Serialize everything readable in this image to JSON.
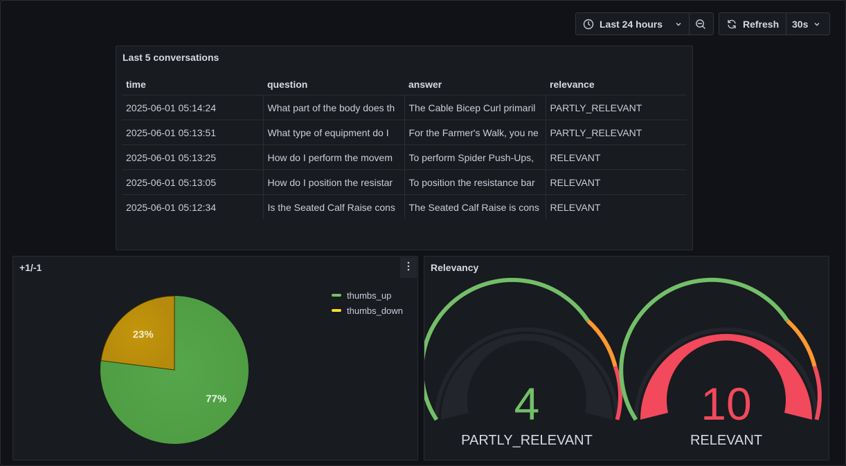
{
  "toolbar": {
    "time_range_label": "Last 24 hours",
    "refresh_label": "Refresh",
    "interval_label": "30s"
  },
  "table_panel": {
    "title": "Last 5 conversations",
    "columns": [
      "time",
      "question",
      "answer",
      "relevance"
    ],
    "rows": [
      [
        "2025-06-01 05:14:24",
        "What part of the body does th",
        "The Cable Bicep Curl primaril",
        "PARTLY_RELEVANT"
      ],
      [
        "2025-06-01 05:13:51",
        "What type of equipment do I",
        "For the Farmer's Walk, you ne",
        "PARTLY_RELEVANT"
      ],
      [
        "2025-06-01 05:13:25",
        "How do I perform the movem",
        "To perform Spider Push-Ups,",
        "RELEVANT"
      ],
      [
        "2025-06-01 05:13:05",
        "How do I position the resistar",
        "To position the resistance bar",
        "RELEVANT"
      ],
      [
        "2025-06-01 05:12:34",
        "Is the Seated Calf Raise cons",
        "The Seated Calf Raise is cons",
        "RELEVANT"
      ]
    ]
  },
  "pie_panel": {
    "title": "+1/-1",
    "legend": [
      {
        "name": "thumbs_up",
        "color": "#73bf69"
      },
      {
        "name": "thumbs_down",
        "color": "#fade2a"
      }
    ],
    "labels": [
      "77%",
      "23%"
    ]
  },
  "gauge_panel": {
    "title": "Relevancy",
    "gauges": [
      {
        "value": "4",
        "label": "PARTLY_RELEVANT",
        "color": "#73bf69"
      },
      {
        "value": "10",
        "label": "RELEVANT",
        "color": "#f2495c"
      }
    ]
  },
  "chart_data": [
    {
      "type": "pie",
      "categories": [
        "thumbs_up",
        "thumbs_down"
      ],
      "values": [
        77,
        23
      ],
      "legend": "top-right"
    }
  ]
}
